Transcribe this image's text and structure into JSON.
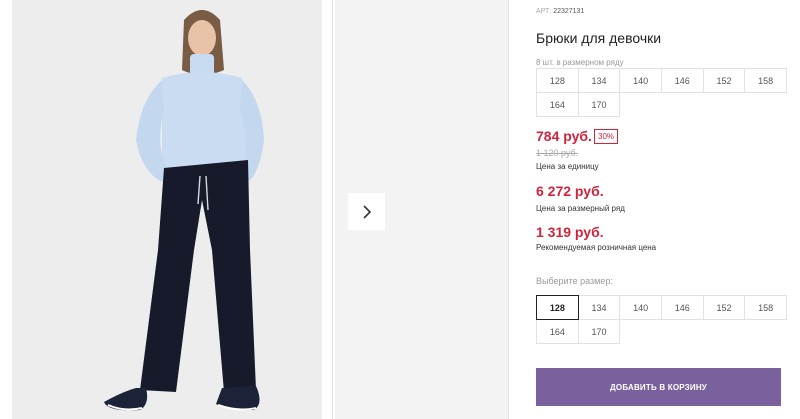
{
  "gallery": {
    "next_icon": "chevron-right-icon"
  },
  "product": {
    "article_label": "АРТ:",
    "article_number": "22327131",
    "title": "Брюки для девочки",
    "pack_caption": "8 шт. в размерном ряду",
    "pack_sizes": [
      "128",
      "134",
      "140",
      "146",
      "152",
      "158",
      "164",
      "170"
    ],
    "price": "784 руб.",
    "discount": "30%",
    "old_price": "1 120 руб.",
    "unit_caption": "Цена за единицу",
    "row_price": "6 272 руб.",
    "row_caption": "Цена за размерный ряд",
    "rrp_price": "1 319 руб.",
    "rrp_caption": "Рекомендуемая розничная цена",
    "choose_caption": "Выберите размер:",
    "sizes": [
      "128",
      "134",
      "140",
      "146",
      "152",
      "158",
      "164",
      "170"
    ],
    "selected_size": "128",
    "add_to_cart": "ДОБАВИТЬ В КОРЗИНУ"
  },
  "colors": {
    "price": "#d2233c",
    "button": "#7a619e"
  }
}
